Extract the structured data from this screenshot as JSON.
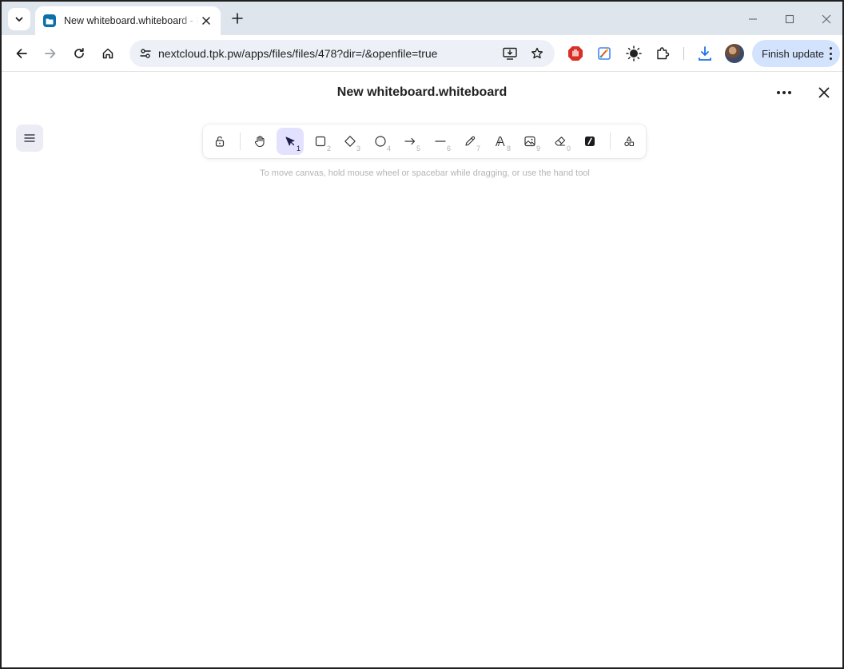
{
  "browser": {
    "tab": {
      "title": "New whiteboard.whiteboard - Nextcloud"
    },
    "address": {
      "url": "nextcloud.tpk.pw/apps/files/files/478?dir=/&openfile=true"
    },
    "finish_update_label": "Finish update"
  },
  "colors": {
    "tab_strip_bg": "#dfe5ed",
    "omnibox_bg": "#edf1f7",
    "finish_update_bg": "#d3e3fd",
    "active_tool_bg": "#e3e2fe",
    "favicon": "#0b6fa8"
  },
  "app": {
    "title": "New whiteboard.whiteboard",
    "hint": "To move canvas, hold mouse wheel or spacebar while dragging, or use the hand tool",
    "tools": [
      {
        "name": "lock",
        "key": ""
      },
      {
        "name": "hand",
        "key": ""
      },
      {
        "name": "selection",
        "key": "1",
        "active": true
      },
      {
        "name": "rectangle",
        "key": "2"
      },
      {
        "name": "diamond",
        "key": "3"
      },
      {
        "name": "ellipse",
        "key": "4"
      },
      {
        "name": "arrow",
        "key": "5"
      },
      {
        "name": "line",
        "key": "6"
      },
      {
        "name": "draw",
        "key": "7"
      },
      {
        "name": "text",
        "key": "8"
      },
      {
        "name": "image",
        "key": "9"
      },
      {
        "name": "eraser",
        "key": "0"
      },
      {
        "name": "laser",
        "key": ""
      },
      {
        "name": "extra-tools",
        "key": ""
      }
    ]
  }
}
